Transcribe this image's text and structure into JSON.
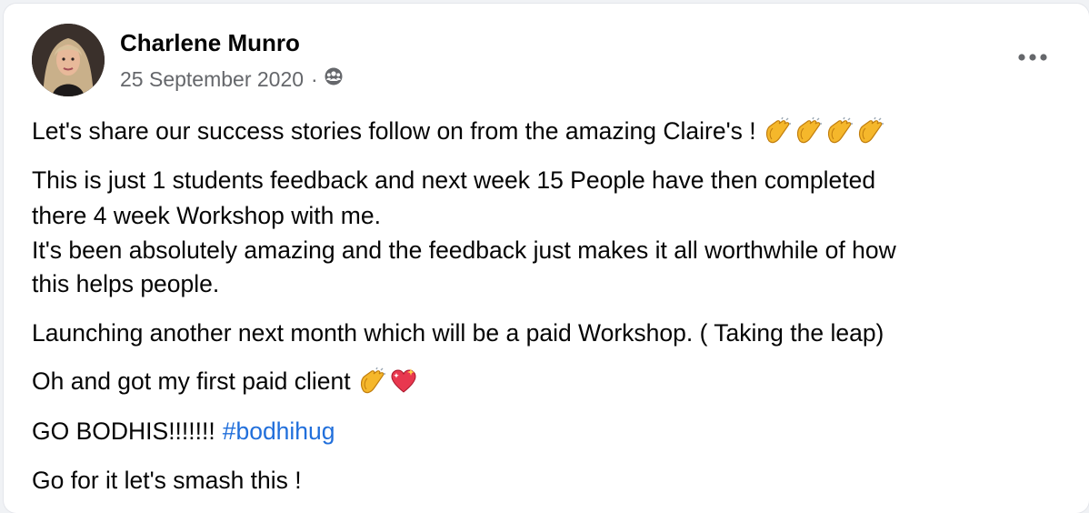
{
  "post": {
    "author": "Charlene Munro",
    "date": "25 September 2020",
    "separator": "·",
    "audience_icon": "group-icon",
    "more_icon": "more-options-icon",
    "lines": {
      "l1": "Let's share our success stories follow on from the amazing Claire's !",
      "l2": "This is just 1 students feedback and next week 15 People have then completed",
      "l3": "there 4 week Workshop with me.",
      "l4": "It's been absolutely amazing and the feedback just makes it all worthwhile of how",
      "l5": "this helps people.",
      "l6": "Launching another next month which will be a paid Workshop. ( Taking the leap)",
      "l7": "Oh and got my first paid client",
      "l8": "GO BODHIS!!!!!!!",
      "l8_hashtag": "#bodhihug",
      "l9": "Go for it let's smash this !"
    },
    "emojis": {
      "l1": [
        "clapping-hands-emoji",
        "clapping-hands-emoji",
        "clapping-hands-emoji",
        "clapping-hands-emoji"
      ],
      "l7": [
        "clapping-hands-emoji",
        "sparkling-heart-emoji"
      ]
    }
  }
}
